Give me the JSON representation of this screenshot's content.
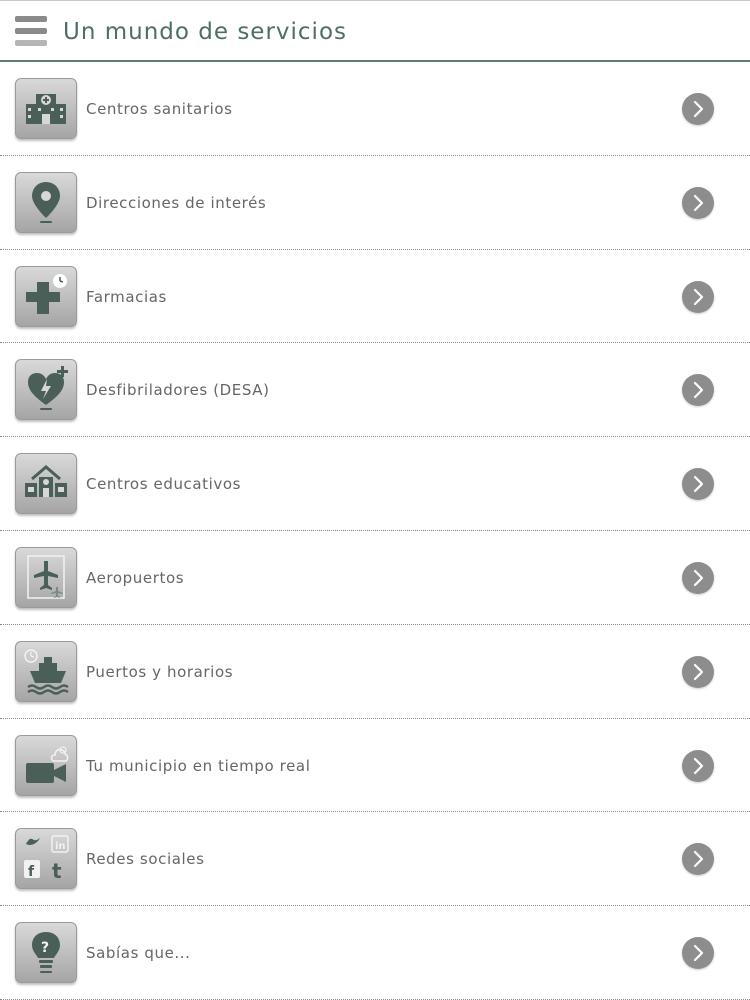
{
  "header": {
    "title": "Un mundo de servicios",
    "menu_icon": "hamburger-menu-icon",
    "accent_color": "#4d6f66"
  },
  "items": [
    {
      "label": "Centros sanitarios",
      "icon": "hospital-icon"
    },
    {
      "label": "Direcciones de interés",
      "icon": "map-pin-icon"
    },
    {
      "label": "Farmacias",
      "icon": "pharmacy-cross-icon"
    },
    {
      "label": "Desfibriladores (DESA)",
      "icon": "defibrillator-heart-icon"
    },
    {
      "label": "Centros educativos",
      "icon": "school-icon"
    },
    {
      "label": "Aeropuertos",
      "icon": "airport-icon"
    },
    {
      "label": "Puertos y horarios",
      "icon": "ship-icon"
    },
    {
      "label": "Tu municipio en tiempo real",
      "icon": "video-camera-icon"
    },
    {
      "label": "Redes sociales",
      "icon": "social-networks-icon"
    },
    {
      "label": "Sabías que...",
      "icon": "lightbulb-question-icon"
    }
  ],
  "chevron_icon": "chevron-right-icon"
}
